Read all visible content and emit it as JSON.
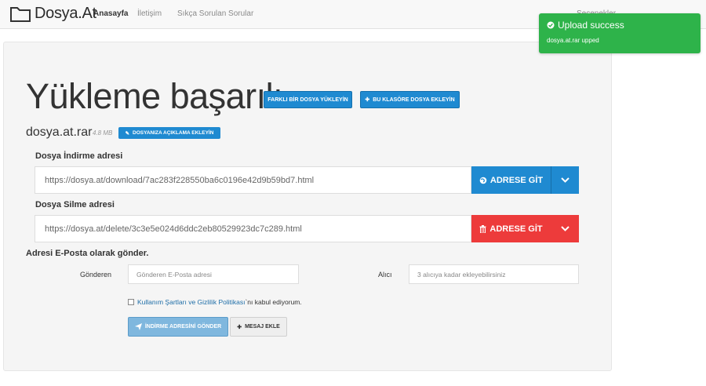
{
  "nav": {
    "brand": "Dosya.At",
    "links": [
      "Anasayfa",
      "İletişim",
      "Sıkça Sorulan Sorular"
    ],
    "right_label": "Seçenekler"
  },
  "main": {
    "title": "Yükleme başarılı",
    "upload_other_label": "FARKLI BİR DOSYA YÜKLEYİN",
    "add_folder_label": "BU KLASÖRE DOSYA EKLEYİN",
    "file_name": "dosya.at.rar",
    "file_size": "4.8 MB",
    "add_description_label": "DOSYANIZA AÇIKLAMA EKLEYİN",
    "download": {
      "label": "Dosya İndirme adresi",
      "url": "https://dosya.at/download/7ac283f228550ba6c0196e42d9b59bd7.html",
      "go_label": "ADRESE GİT"
    },
    "delete": {
      "label": "Dosya Silme adresi",
      "url": "https://dosya.at/delete/3c3e5e024d6ddc2eb80529923dc7c289.html",
      "go_label": "ADRESE GİT"
    },
    "email": {
      "heading": "Adresi E-Posta olarak gönder.",
      "sender_label": "Gönderen",
      "sender_placeholder": "Gönderen E-Posta adresi",
      "recipient_label": "Alıcı",
      "recipient_placeholder": "3 alıcıya kadar ekleyebilirsiniz",
      "terms_link": "Kullanım Şartları ve Gizlilik Politikası",
      "terms_suffix": "`nı kabul ediyorum.",
      "send_label": "İNDİRME ADRESİNİ GÖNDER",
      "add_message_label": "MESAJ EKLE"
    }
  },
  "toast": {
    "title": "Upload success",
    "message": "dosya.at.rar upped"
  },
  "colors": {
    "primary": "#1f8ad1",
    "danger": "#ed3b3b",
    "success": "#2eb34a"
  }
}
